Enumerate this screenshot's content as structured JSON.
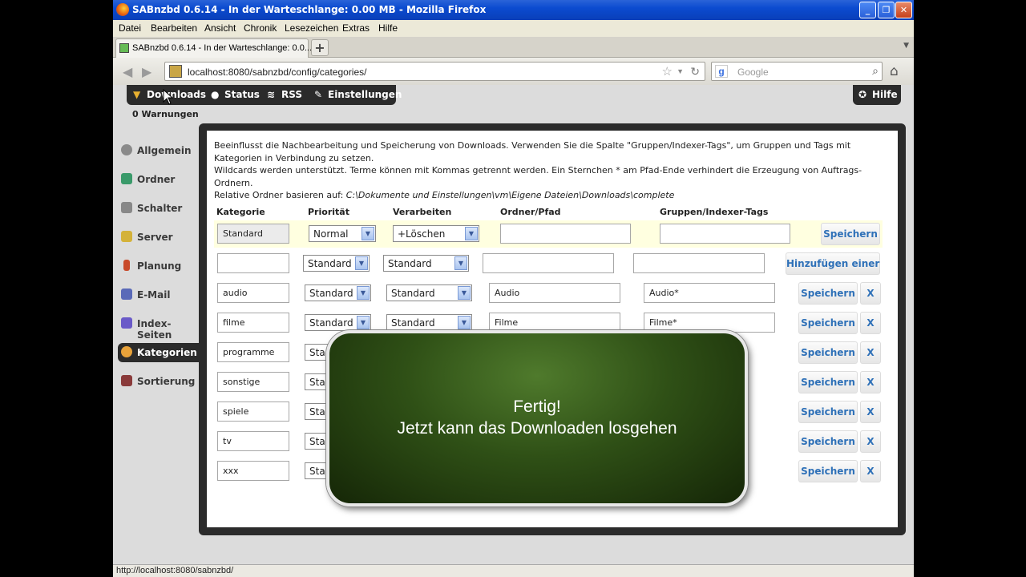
{
  "window": {
    "title": "SABnzbd 0.6.14 - In der Warteschlange: 0.00 MB - Mozilla Firefox",
    "controls": [
      "_",
      "❐",
      "✕"
    ]
  },
  "menu": [
    "Datei",
    "Bearbeiten",
    "Ansicht",
    "Chronik",
    "Lesezeichen",
    "Extras",
    "Hilfe"
  ],
  "tab": {
    "label": "SABnzbd 0.6.14 - In der Warteschlange: 0.0...",
    "new_tab": "+"
  },
  "address": {
    "url": "localhost:8080/sabnzbd/config/categories/",
    "search_placeholder": "Google"
  },
  "topnav": {
    "items": [
      "Downloads",
      "Status",
      "RSS",
      "Einstellungen"
    ],
    "help": "Hilfe",
    "warnings": "0 Warnungen"
  },
  "sidebar": {
    "items": [
      {
        "label": "Allgemein",
        "icon": "gear-icon",
        "color": "#8a8a8a"
      },
      {
        "label": "Ordner",
        "icon": "folder-icon",
        "color": "#3a9a6a"
      },
      {
        "label": "Schalter",
        "icon": "switch-icon",
        "color": "#888888"
      },
      {
        "label": "Server",
        "icon": "server-icon",
        "color": "#d4b23a"
      },
      {
        "label": "Planung",
        "icon": "schedule-icon",
        "color": "#c84a2a"
      },
      {
        "label": "E-Mail",
        "icon": "mail-icon",
        "color": "#5a6ab8"
      },
      {
        "label": "Index-Seiten",
        "icon": "index-icon",
        "color": "#6a5ac8"
      },
      {
        "label": "Kategorien",
        "icon": "palette-icon",
        "color": "#e8a23a"
      },
      {
        "label": "Sortierung",
        "icon": "sort-icon",
        "color": "#8a3a3a"
      }
    ],
    "active": "Kategorien"
  },
  "description": {
    "line1": "Beeinflusst die Nachbearbeitung und Speicherung von Downloads. Verwenden Sie die Spalte \"Gruppen/Indexer-Tags\", um Gruppen und Tags mit Kategorien in Verbindung zu setzen.",
    "line2": "Wildcards werden unterstützt. Terme können mit Kommas getrennt werden. Ein Sternchen * am Pfad-Ende verhindert die Erzeugung von Auftrags-Ordnern.",
    "line3_prefix": "Relative Ordner basieren auf: ",
    "line3_path": "C:\\Dokumente und Einstellungen\\vm\\Eigene Dateien\\Downloads\\complete"
  },
  "table": {
    "headers": [
      "Kategorie",
      "Priorität",
      "Verarbeiten",
      "Ordner/Pfad",
      "Gruppen/Indexer-Tags"
    ],
    "rows": [
      {
        "name": "Standard",
        "priority": "Normal",
        "process": "+Löschen",
        "folder": "",
        "tags": "",
        "button": "Speichern",
        "delete": ""
      },
      {
        "name": "",
        "priority": "Standard",
        "process": "Standard",
        "folder": "",
        "tags": "",
        "button": "Hinzufügen einer",
        "delete": ""
      },
      {
        "name": "audio",
        "priority": "Standard",
        "process": "Standard",
        "folder": "Audio",
        "tags": "Audio*",
        "button": "Speichern",
        "delete": "X"
      },
      {
        "name": "filme",
        "priority": "Standard",
        "process": "Standard",
        "folder": "Filme",
        "tags": "Filme*",
        "button": "Speichern",
        "delete": "X"
      },
      {
        "name": "programme",
        "priority": "Sta",
        "process": "",
        "folder": "",
        "tags": "",
        "button": "Speichern",
        "delete": "X"
      },
      {
        "name": "sonstige",
        "priority": "Sta",
        "process": "",
        "folder": "",
        "tags": "",
        "button": "Speichern",
        "delete": "X"
      },
      {
        "name": "spiele",
        "priority": "Sta",
        "process": "",
        "folder": "",
        "tags": "",
        "button": "Speichern",
        "delete": "X"
      },
      {
        "name": "tv",
        "priority": "Sta",
        "process": "",
        "folder": "",
        "tags": "",
        "button": "Speichern",
        "delete": "X"
      },
      {
        "name": "xxx",
        "priority": "Sta",
        "process": "",
        "folder": "",
        "tags": "",
        "button": "Speichern",
        "delete": "X"
      }
    ]
  },
  "overlay": {
    "line1": "Fertig!",
    "line2": "Jetzt kann das Downloaden losgehen"
  },
  "statusbar": {
    "text": "http://localhost:8080/sabnzbd/"
  }
}
